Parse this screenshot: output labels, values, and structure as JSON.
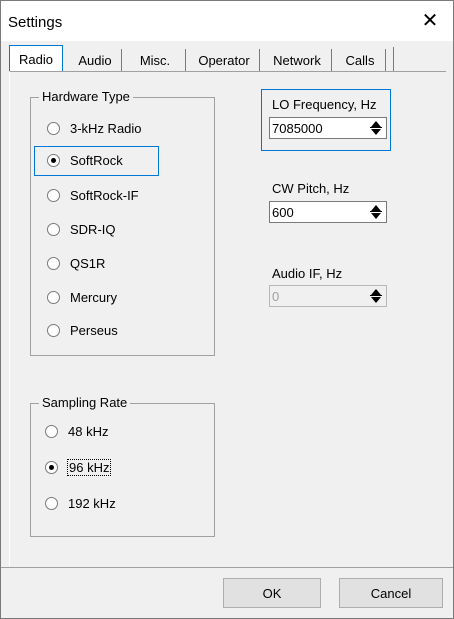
{
  "window": {
    "title": "Settings",
    "close_glyph": "✕"
  },
  "tabs": [
    {
      "label": "Radio",
      "active": true
    },
    {
      "label": "Audio"
    },
    {
      "label": "Misc."
    },
    {
      "label": "Operator"
    },
    {
      "label": "Network"
    },
    {
      "label": "Calls"
    }
  ],
  "hardware": {
    "legend": "Hardware Type",
    "options": [
      "3-kHz Radio",
      "SoftRock",
      "SoftRock-IF",
      "SDR-IQ",
      "QS1R",
      "Mercury",
      "Perseus"
    ],
    "selected": "SoftRock"
  },
  "sampling": {
    "legend": "Sampling Rate",
    "options": [
      "48 kHz",
      "96 kHz",
      "192 kHz"
    ],
    "selected": "96 kHz"
  },
  "lo_frequency": {
    "label": "LO Frequency, Hz",
    "value": "7085000"
  },
  "cw_pitch": {
    "label": "CW Pitch, Hz",
    "value": "600"
  },
  "audio_if": {
    "label": "Audio IF, Hz",
    "value": "0",
    "disabled": true
  },
  "buttons": {
    "ok": "OK",
    "cancel": "Cancel"
  },
  "colors": {
    "accent": "#0078d7",
    "background": "#f0f0f0"
  },
  "icons": {
    "spin": "spin-updown-icon"
  }
}
